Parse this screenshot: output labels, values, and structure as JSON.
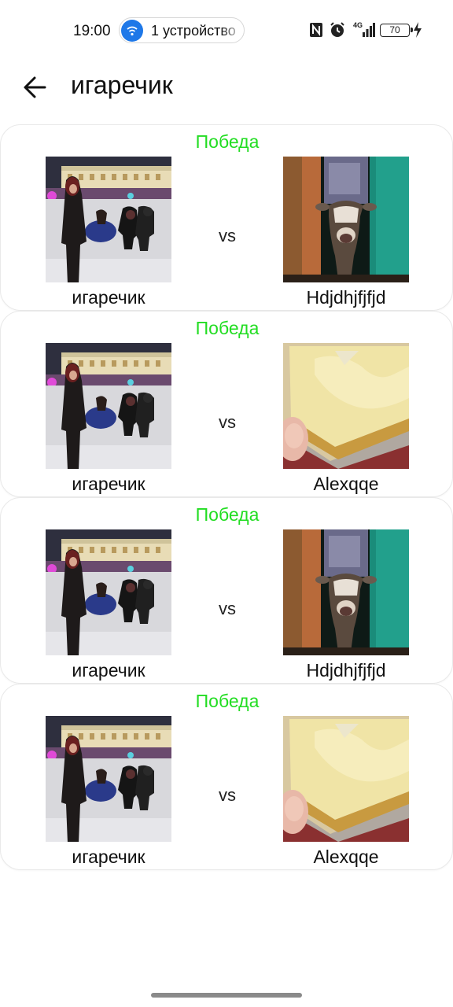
{
  "status_bar": {
    "time": "19:00",
    "pill_text": "1 устройство",
    "battery": "70",
    "network": "4G",
    "icons": [
      "nfc-icon",
      "alarm-icon",
      "signal-icon",
      "battery-icon",
      "charging-icon"
    ]
  },
  "header": {
    "title": "игаречик",
    "back_icon": "arrow-left-icon"
  },
  "matches": [
    {
      "result": "Победа",
      "player": "игаречик",
      "vs": "vs",
      "opponent": "Hdjdhjfjfjd",
      "opponent_photo": "cow-photo"
    },
    {
      "result": "Победа",
      "player": "игаречик",
      "vs": "vs",
      "opponent": "Alexqqe",
      "opponent_photo": "pizza-photo"
    },
    {
      "result": "Победа",
      "player": "игаречик",
      "vs": "vs",
      "opponent": "Hdjdhjfjfjd",
      "opponent_photo": "cow-photo"
    },
    {
      "result": "Победа",
      "player": "игаречик",
      "vs": "vs",
      "opponent": "Alexqqe",
      "opponent_photo": "pizza-photo"
    }
  ],
  "colors": {
    "win": "#22dd22",
    "pill_icon": "#1e78e8"
  }
}
